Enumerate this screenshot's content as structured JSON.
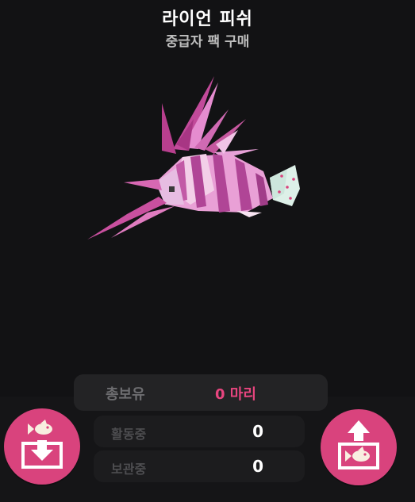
{
  "header": {
    "title": "라이언 피쉬",
    "subtitle": "중급자 팩 구매"
  },
  "fish": {
    "icon": "lionfish-3d-model",
    "colors": {
      "body": "#e9a0d6",
      "stripe": "#b04596",
      "fin": "#c9509f",
      "tail": "#ddf0e8"
    }
  },
  "stats": {
    "total_label": "총보유",
    "total_value": "0 마리",
    "active_label": "활동중",
    "active_value": "0",
    "stored_label": "보관중",
    "stored_value": "0"
  },
  "buttons": {
    "store_icon": "fish-into-box-icon",
    "release_icon": "fish-out-of-box-icon"
  },
  "colors": {
    "background": "#121214",
    "accent": "#d9437d",
    "highlight_text": "#e8457f"
  }
}
